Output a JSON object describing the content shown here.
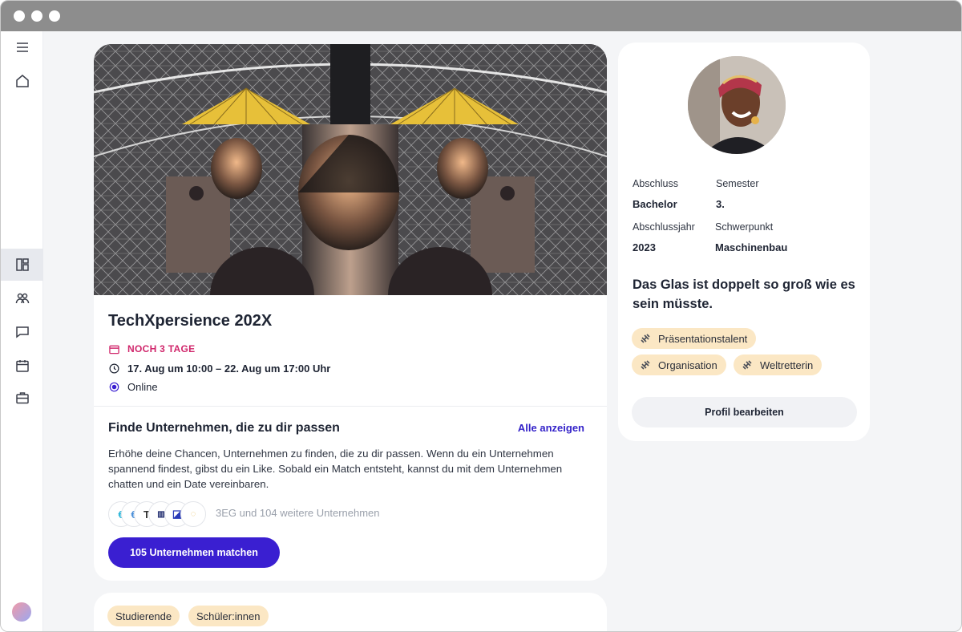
{
  "colors": {
    "accent": "#3a1fd1",
    "deadline": "#d0266b",
    "chip_background": "#fbe7c4",
    "page_background": "#f4f5f7"
  },
  "sidebar": {
    "items": [
      {
        "name": "menu",
        "icon": "hamburger-icon"
      },
      {
        "name": "home",
        "icon": "home-icon"
      },
      {
        "name": "dashboard",
        "icon": "dashboard-icon",
        "active": true
      },
      {
        "name": "companies",
        "icon": "people-icon"
      },
      {
        "name": "messages",
        "icon": "chat-icon"
      },
      {
        "name": "calendar",
        "icon": "calendar-icon"
      },
      {
        "name": "jobs",
        "icon": "briefcase-icon"
      }
    ]
  },
  "event": {
    "title": "TechXpersience 202X",
    "deadline": "NOCH 3 TAGE",
    "dates": "17. Aug um 10:00 – 22. Aug um 17:00 Uhr",
    "location": "Online"
  },
  "match_section": {
    "title": "Finde Unternehmen, die zu dir passen",
    "show_all": "Alle anzeigen",
    "text": "Erhöhe deine Chancen, Unternehmen zu finden, die zu dir passen. Wenn du ein Unternehmen spannend findest, gibst du ein Like. Sobald ein Match entsteht, kannst du mit dem Unternehmen chatten und ein Date vereinbaren.",
    "companies_text": "3EG und 104 weitere Unternehmen",
    "button": "105 Unternehmen matchen"
  },
  "audience_tags": [
    "Studierende",
    "Schüler:innen"
  ],
  "profile": {
    "labels": {
      "degree": "Abschluss",
      "semester": "Semester",
      "graduation_year": "Abschlussjahr",
      "focus": "Schwerpunkt"
    },
    "values": {
      "degree": "Bachelor",
      "semester": "3.",
      "graduation_year": "2023",
      "focus": "Maschinenbau"
    },
    "quote": "Das Glas ist doppelt so groß wie es sein müsste.",
    "skills": [
      "Präsentationstalent",
      "Organisation",
      "Weltretterin"
    ],
    "edit_button": "Profil bearbeiten"
  }
}
